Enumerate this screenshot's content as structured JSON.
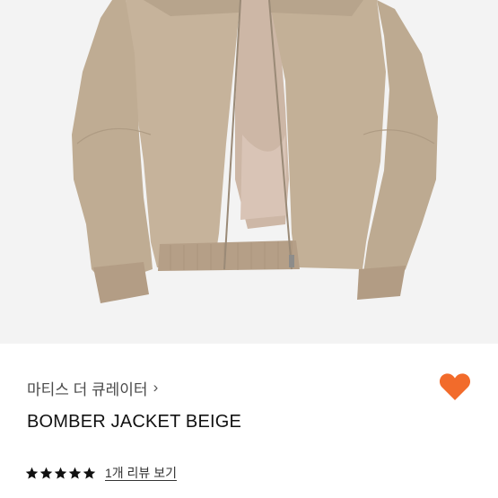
{
  "image": {
    "subject": "beige nylon bomber jacket",
    "background_color": "#f3f3f3",
    "jacket_color": "#c6b39b"
  },
  "brand": {
    "label": "마티스 더 큐레이터",
    "chevron": "›"
  },
  "product": {
    "title": "BOMBER JACKET BEIGE"
  },
  "like": {
    "icon": "heart-icon",
    "color": "#f26b2b",
    "active": true
  },
  "rating": {
    "stars": 5,
    "max": 5,
    "star_color": "#111111",
    "review_link": "1개 리뷰 보기"
  }
}
